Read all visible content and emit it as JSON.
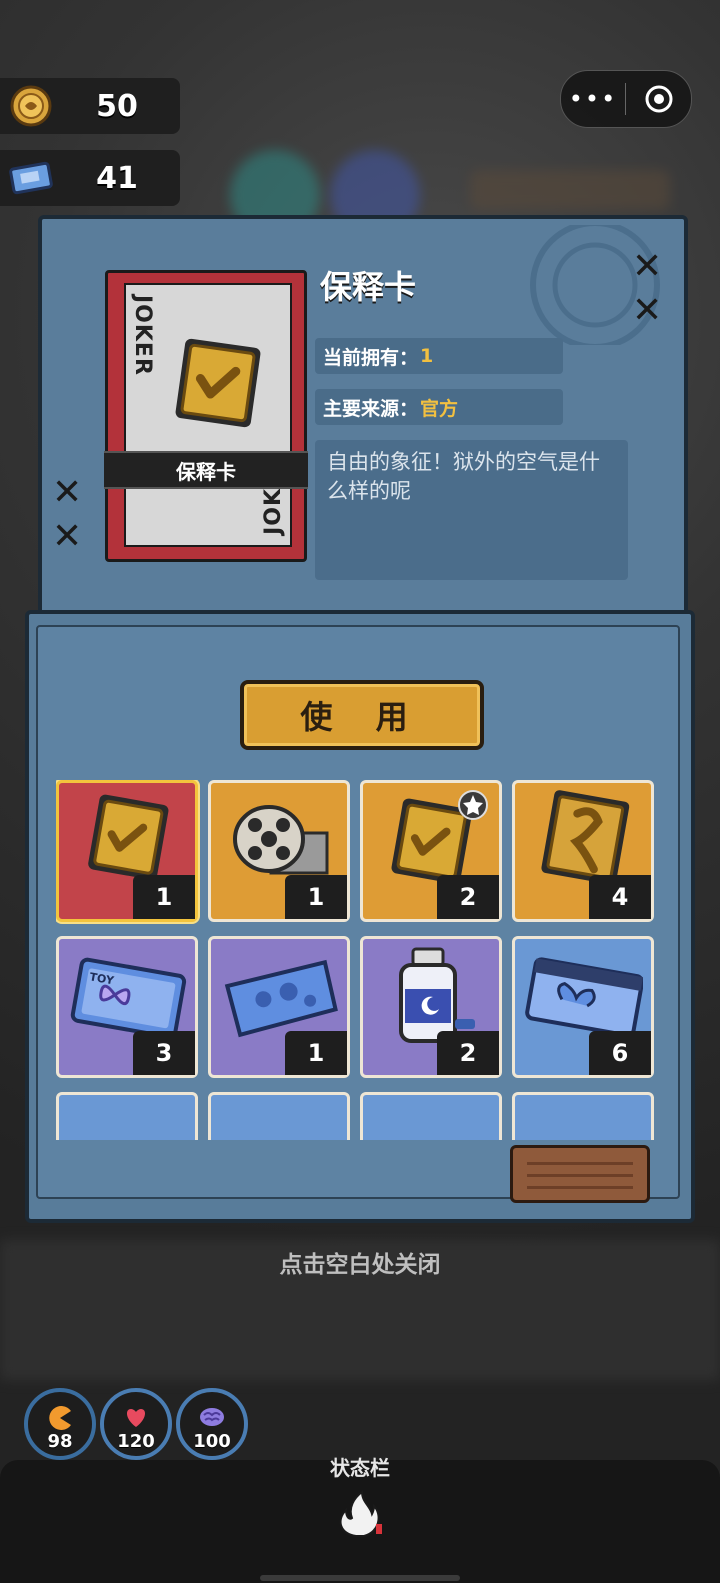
{
  "currency": {
    "coins": "50",
    "tickets": "41"
  },
  "capsule": {
    "more": "•••",
    "close_icon": "target-icon"
  },
  "item": {
    "title": "保释卡",
    "card_label": "保释卡",
    "joker_text": "JOKER",
    "owned_label": "当前拥有：",
    "owned_value": "1",
    "source_label": "主要来源：",
    "source_value": "官方",
    "description": "自由的象征！狱外的空气是什么样的呢"
  },
  "use_button": "使 用",
  "inventory": [
    {
      "icon": "bail-card-icon",
      "bg": "red",
      "count": "1",
      "selected": true
    },
    {
      "icon": "film-reel-icon",
      "bg": "orange",
      "count": "1",
      "selected": false
    },
    {
      "icon": "bail-card-star-icon",
      "bg": "orange",
      "count": "2",
      "selected": false
    },
    {
      "icon": "ribbon-card-icon",
      "bg": "orange",
      "count": "4",
      "selected": false
    },
    {
      "icon": "toy-ticket-icon",
      "bg": "purple",
      "count": "3",
      "selected": false
    },
    {
      "icon": "blue-ticket-icon",
      "bg": "purple",
      "count": "1",
      "selected": false
    },
    {
      "icon": "moon-bottle-icon",
      "bg": "purple",
      "count": "2",
      "selected": false
    },
    {
      "icon": "blue-coupon-icon",
      "bg": "blue",
      "count": "6",
      "selected": false
    }
  ],
  "close_hint": "点击空白处关闭",
  "stats": [
    {
      "icon": "pacman-icon",
      "value": "98"
    },
    {
      "icon": "heart-icon",
      "value": "120"
    },
    {
      "icon": "brain-icon",
      "value": "100"
    }
  ],
  "status_label": "状态栏",
  "colors": {
    "panel": "#5a7d9b",
    "accent": "#f2c040",
    "card_red": "#b3323a"
  }
}
